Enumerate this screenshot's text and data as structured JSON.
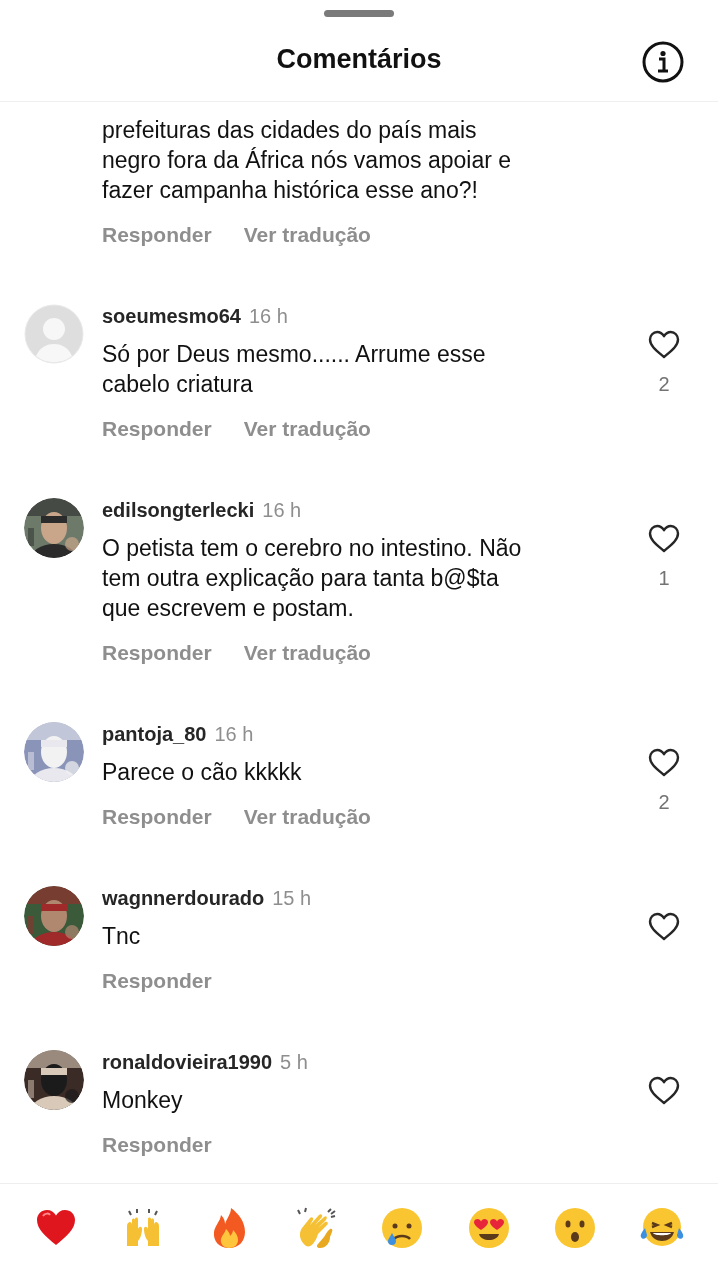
{
  "sheet": {
    "title": "Comentários"
  },
  "comments": [
    {
      "kind": "continued",
      "text": "prefeituras das cidades do país mais\nnegro fora da África nós vamos apoiar e\nfazer campanha histórica esse ano?!",
      "actions": [
        "Responder",
        "Ver tradução"
      ]
    },
    {
      "kind": "full",
      "avatar": {
        "kind": "default"
      },
      "username": "soeumesmo64",
      "time": "16 h",
      "text": "Só por Deus mesmo...... Arrume esse\ncabelo criatura",
      "likes": "2",
      "actions": [
        "Responder",
        "Ver tradução"
      ]
    },
    {
      "kind": "full",
      "avatar": {
        "kind": "picture"
      },
      "username": "edilsongterlecki",
      "time": "16 h",
      "text": "O petista tem o cerebro no intestino. Não\ntem outra explicação para tanta b@$ta\nque escrevem e postam.",
      "likes": "1",
      "actions": [
        "Responder",
        "Ver tradução"
      ]
    },
    {
      "kind": "full",
      "avatar": {
        "kind": "picture"
      },
      "username": "pantoja_80",
      "time": "16 h",
      "text": "Parece o cão kkkkk",
      "likes": "2",
      "actions": [
        "Responder",
        "Ver tradução"
      ]
    },
    {
      "kind": "full",
      "avatar": {
        "kind": "picture"
      },
      "username": "wagnnerdourado",
      "time": "15 h",
      "text": "Tnc",
      "actions": [
        "Responder"
      ]
    },
    {
      "kind": "full",
      "avatar": {
        "kind": "picture"
      },
      "username": "ronaldovieira1990",
      "time": "5 h",
      "text": "Monkey",
      "actions": [
        "Responder"
      ]
    }
  ],
  "reactions": [
    {
      "kind": "heart"
    },
    {
      "kind": "raised_hands"
    },
    {
      "kind": "fire"
    },
    {
      "kind": "clap"
    },
    {
      "kind": "crying"
    },
    {
      "kind": "heart_eyes"
    },
    {
      "kind": "surprised"
    },
    {
      "kind": "laughing"
    }
  ]
}
